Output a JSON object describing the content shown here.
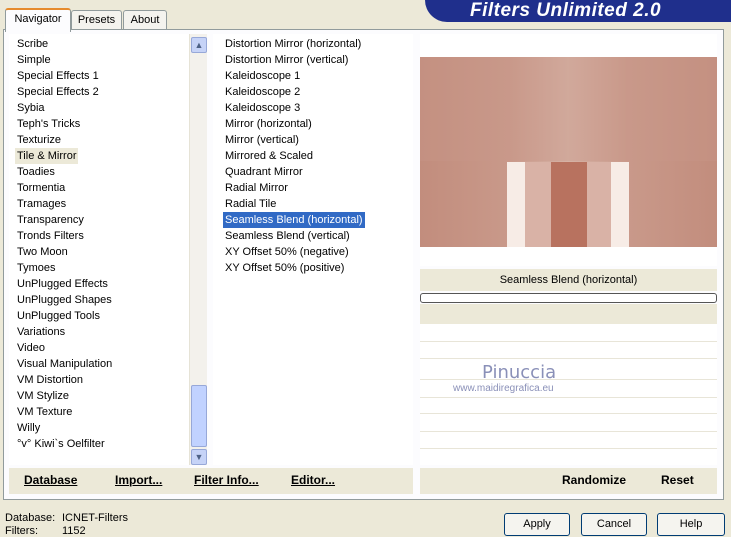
{
  "banner": {
    "title": "Filters Unlimited 2.0"
  },
  "tabs": [
    "Navigator",
    "Presets",
    "About"
  ],
  "categories": {
    "items": [
      "Scribe",
      "Simple",
      "Special Effects 1",
      "Special Effects 2",
      "Sybia",
      "Teph's Tricks",
      "Texturize",
      "Tile & Mirror",
      "Toadies",
      "Tormentia",
      "Tramages",
      "Transparency",
      "Tronds Filters",
      "Two Moon",
      "Tymoes",
      "UnPlugged Effects",
      "UnPlugged Shapes",
      "UnPlugged Tools",
      "Variations",
      "Video",
      "Visual Manipulation",
      "VM Distortion",
      "VM Stylize",
      "VM Texture",
      "Willy",
      "°v° Kiwi`s Oelfilter"
    ],
    "highlighted_index": 7
  },
  "filters": {
    "items": [
      "Distortion Mirror (horizontal)",
      "Distortion Mirror (vertical)",
      "Kaleidoscope 1",
      "Kaleidoscope 2",
      "Kaleidoscope 3",
      "Mirror (horizontal)",
      "Mirror (vertical)",
      "Mirrored & Scaled",
      "Quadrant Mirror",
      "Radial Mirror",
      "Radial Tile",
      "Seamless Blend (horizontal)",
      "Seamless Blend (vertical)",
      "XY Offset 50% (negative)",
      "XY Offset 50% (positive)"
    ],
    "selected_index": 11
  },
  "preview": {
    "filter_name": "Seamless Blend (horizontal)",
    "watermark_name": "Pinuccia",
    "watermark_url": "www.maidiregrafica.eu",
    "colors": {
      "base": "#c08a7a",
      "light": "#e2c3b7",
      "white": "#f7ece6",
      "dark": "#b06e5c"
    }
  },
  "left_buttons": {
    "database": "Database",
    "import": "Import...",
    "filter_info": "Filter Info...",
    "editor": "Editor..."
  },
  "right_buttons": {
    "randomize": "Randomize",
    "reset": "Reset"
  },
  "status": {
    "database_label": "Database:",
    "database_value": "ICNET-Filters",
    "filters_label": "Filters:",
    "filters_value": "1152"
  },
  "dialog_buttons": {
    "apply": "Apply",
    "cancel": "Cancel",
    "help": "Help"
  },
  "scroll_arrows": {
    "up": "▲",
    "down": "▼"
  }
}
